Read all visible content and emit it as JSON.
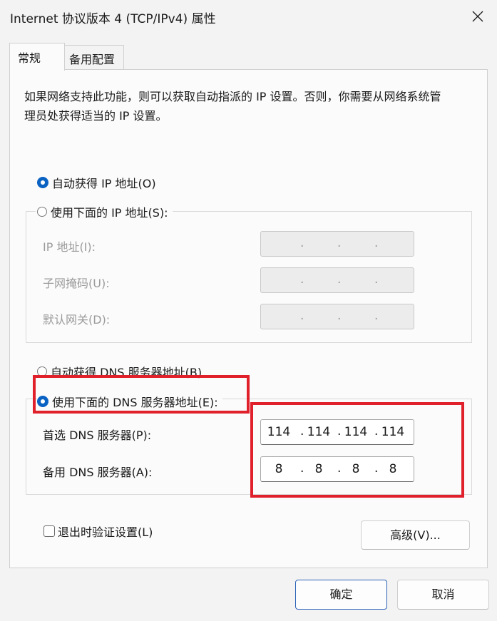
{
  "window": {
    "title": "Internet 协议版本 4 (TCP/IPv4) 属性"
  },
  "tabs": [
    {
      "label": "常规",
      "selected": true
    },
    {
      "label": "备用配置",
      "selected": false
    }
  ],
  "description": "如果网络支持此功能，则可以获取自动指派的 IP 设置。否则，你需要从网络系统管理员处获得适当的 IP 设置。",
  "ip_section": {
    "auto_label": "自动获得 IP 地址(O)",
    "auto_selected": true,
    "manual_label": "使用下面的 IP 地址(S):",
    "manual_selected": false,
    "fields": [
      {
        "label": "IP 地址(I):",
        "value": [
          "",
          "",
          "",
          ""
        ],
        "enabled": false
      },
      {
        "label": "子网掩码(U):",
        "value": [
          "",
          "",
          "",
          ""
        ],
        "enabled": false
      },
      {
        "label": "默认网关(D):",
        "value": [
          "",
          "",
          "",
          ""
        ],
        "enabled": false
      }
    ]
  },
  "dns_section": {
    "auto_label": "自动获得 DNS 服务器地址(B)",
    "auto_selected": false,
    "manual_label": "使用下面的 DNS 服务器地址(E):",
    "manual_selected": true,
    "preferred": {
      "label": "首选 DNS 服务器(P):",
      "value": [
        "114",
        "114",
        "114",
        "114"
      ]
    },
    "alternate": {
      "label": "备用 DNS 服务器(A):",
      "value": [
        "8",
        "8",
        "8",
        "8"
      ]
    }
  },
  "validate_on_exit": {
    "label": "退出时验证设置(L)",
    "checked": false
  },
  "buttons": {
    "advanced": "高级(V)...",
    "ok": "确定",
    "cancel": "取消"
  },
  "colors": {
    "accent": "#0a62c2",
    "highlight": "#e0202b"
  }
}
